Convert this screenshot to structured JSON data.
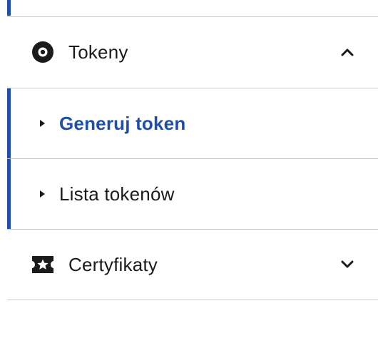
{
  "nav": {
    "tokens": {
      "label": "Tokeny",
      "icon": "disc-icon",
      "state": "expanded",
      "children": [
        {
          "label": "Generuj token",
          "active": true
        },
        {
          "label": "Lista tokenów",
          "active": false
        }
      ]
    },
    "certificates": {
      "label": "Certyfikaty",
      "icon": "star-ticket-icon",
      "state": "collapsed"
    }
  },
  "colors": {
    "accent": "#1f4fa8",
    "text": "#1b1b1b",
    "divider": "#c9c9c9"
  }
}
